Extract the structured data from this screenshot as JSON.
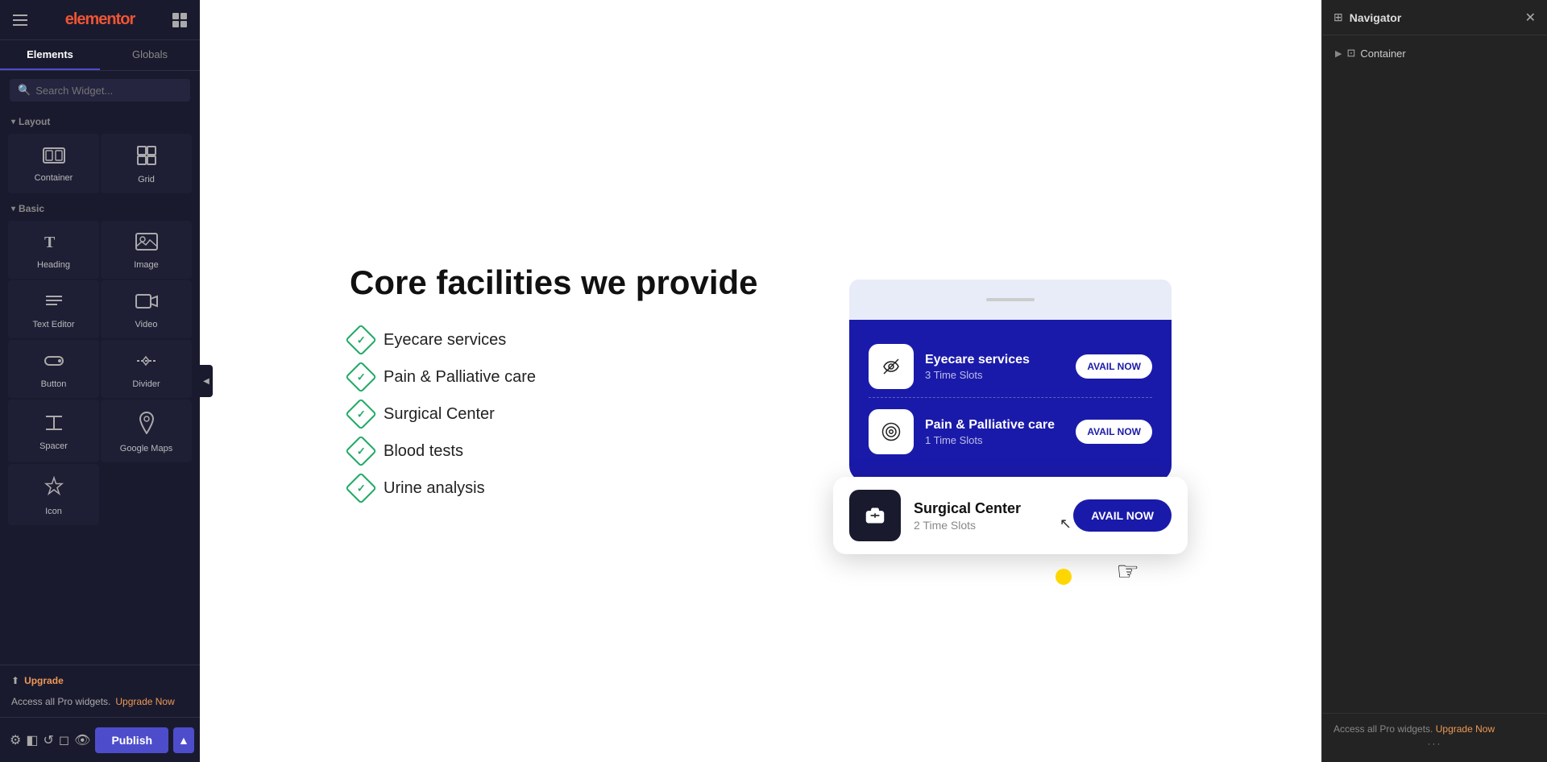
{
  "app": {
    "title": "elementor",
    "tabs": {
      "elements": "Elements",
      "globals": "Globals"
    }
  },
  "search": {
    "placeholder": "Search Widget..."
  },
  "sidebar": {
    "sections": {
      "layout": {
        "label": "Layout",
        "widgets": [
          {
            "id": "container",
            "label": "Container",
            "icon": "container"
          },
          {
            "id": "grid",
            "label": "Grid",
            "icon": "grid"
          }
        ]
      },
      "basic": {
        "label": "Basic",
        "widgets": [
          {
            "id": "heading",
            "label": "Heading",
            "icon": "heading"
          },
          {
            "id": "image",
            "label": "Image",
            "icon": "image"
          },
          {
            "id": "text-editor",
            "label": "Text Editor",
            "icon": "text-editor"
          },
          {
            "id": "video",
            "label": "Video",
            "icon": "video"
          },
          {
            "id": "button",
            "label": "Button",
            "icon": "button"
          },
          {
            "id": "divider",
            "label": "Divider",
            "icon": "divider"
          },
          {
            "id": "spacer",
            "label": "Spacer",
            "icon": "spacer"
          },
          {
            "id": "google-maps",
            "label": "Google Maps",
            "icon": "google-maps"
          },
          {
            "id": "icon",
            "label": "Icon",
            "icon": "icon"
          }
        ]
      }
    },
    "upgrade_label": "Upgrade",
    "upgrade_banner": "Access all Pro widgets.",
    "upgrade_link": "Upgrade Now"
  },
  "toolbar": {
    "publish_label": "Publish"
  },
  "canvas": {
    "title": "Core facilities we provide",
    "facilities": [
      {
        "name": "Eyecare services"
      },
      {
        "name": "Pain & Palliative care"
      },
      {
        "name": "Surgical Center"
      },
      {
        "name": "Blood tests"
      },
      {
        "name": "Urine analysis"
      }
    ],
    "cards": [
      {
        "id": "eyecare",
        "name": "Eyecare services",
        "slots": "3 Time Slots",
        "avail_label": "AVAIL NOW"
      },
      {
        "id": "pain",
        "name": "Pain & Palliative care",
        "slots": "1 Time Slots",
        "avail_label": "AVAIL NOW"
      }
    ],
    "floating_card": {
      "name": "Surgical Center",
      "slots": "2 Time Slots",
      "avail_label": "AVAIL NOW"
    }
  },
  "navigator": {
    "title": "Navigator",
    "tree": [
      {
        "label": "Container",
        "type": "container"
      }
    ],
    "footer_text": "Access all Pro widgets.",
    "upgrade_link": "Upgrade Now"
  }
}
